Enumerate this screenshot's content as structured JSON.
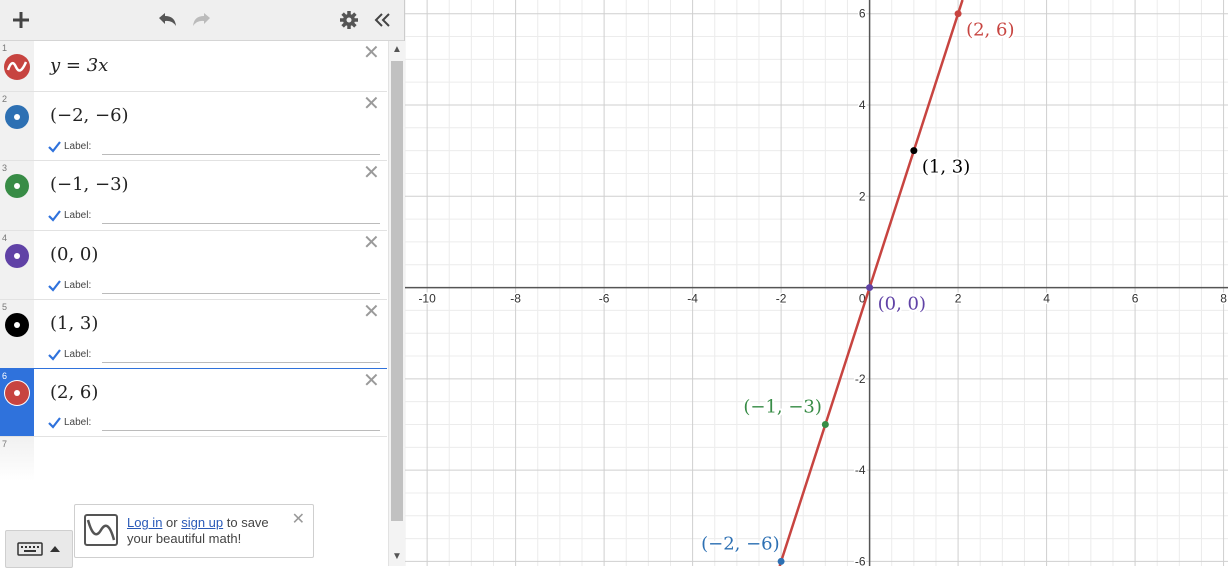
{
  "toolbar": {
    "icons": [
      "plus-icon",
      "undo-icon",
      "redo-icon",
      "gear-icon",
      "collapse-icon"
    ]
  },
  "expressions": [
    {
      "num": "1",
      "latex": "y = 3x",
      "type": "function",
      "color": "#c74440"
    },
    {
      "num": "2",
      "latex": "(−2, −6)",
      "type": "point",
      "color": "#2d70b3",
      "label_text": "Label:"
    },
    {
      "num": "3",
      "latex": "(−1, −3)",
      "type": "point",
      "color": "#388c46",
      "label_text": "Label:"
    },
    {
      "num": "4",
      "latex": "(0, 0)",
      "type": "point",
      "color": "#6042a6",
      "label_text": "Label:"
    },
    {
      "num": "5",
      "latex": "(1, 3)",
      "type": "point",
      "color": "#000000",
      "label_text": "Label:"
    },
    {
      "num": "6",
      "latex": "(2, 6)",
      "type": "point",
      "color": "#c74440",
      "label_text": "Label:",
      "selected": true
    },
    {
      "num": "7",
      "latex": "",
      "type": "empty"
    }
  ],
  "login": {
    "log_in": "Log in",
    "or": " or ",
    "sign_up": "sign up",
    "rest": " to save your beautiful math!"
  },
  "chart_data": {
    "type": "scatter",
    "xlim": [
      -10.5,
      8.1
    ],
    "ylim": [
      -6.1,
      6.3
    ],
    "grid": true,
    "x_ticks": [
      -10,
      -8,
      -6,
      -4,
      -2,
      0,
      2,
      4,
      6,
      8
    ],
    "y_ticks": [
      -6,
      -4,
      -2,
      2,
      4,
      6
    ],
    "line": {
      "expr": "y = 3x",
      "slope": 3,
      "color": "#c74440"
    },
    "points": [
      {
        "x": -2,
        "y": -6,
        "label": "(−2, −6)",
        "color": "#2d70b3"
      },
      {
        "x": -1,
        "y": -3,
        "label": "(−1, −3)",
        "color": "#388c46"
      },
      {
        "x": 0,
        "y": 0,
        "label": "(0, 0)",
        "color": "#6042a6"
      },
      {
        "x": 1,
        "y": 3,
        "label": "(1, 3)",
        "color": "#000000"
      },
      {
        "x": 2,
        "y": 6,
        "label": "(2, 6)",
        "color": "#c74440"
      }
    ]
  }
}
